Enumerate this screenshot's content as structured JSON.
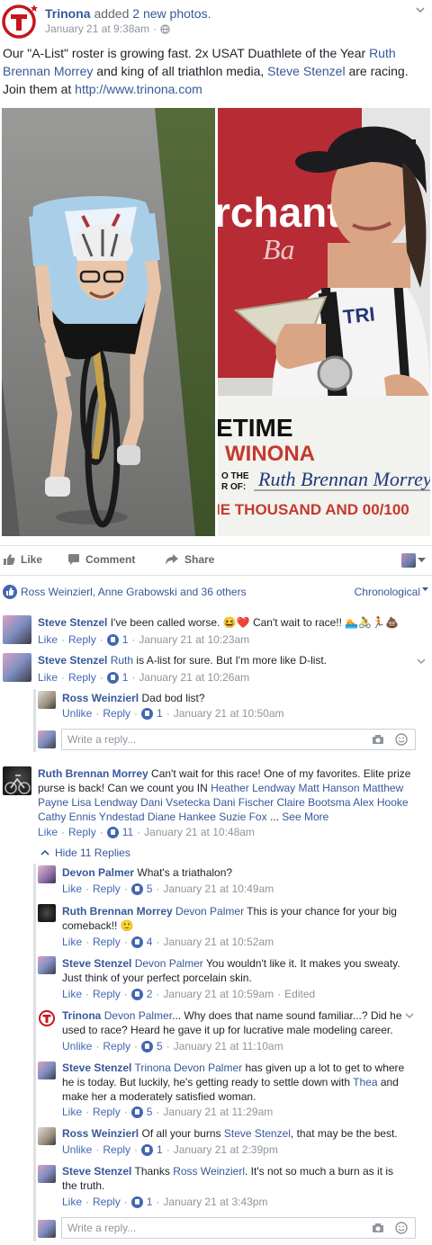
{
  "post": {
    "page_name": "Trinona",
    "action": "added",
    "photo_count": "2 new photos",
    "period": ".",
    "timestamp": "January 21 at 9:38am",
    "privacy_icon": "globe-icon",
    "text": {
      "p1": "Our \"A-List\" roster is growing fast. 2x USAT Duathlete of the Year ",
      "link1": "Ruth Brennan Morrey",
      "p2": " and king of all triathlon media, ",
      "link2": "Steve Stenzel",
      "p3": " are racing. Join them at ",
      "url": "http://www.trinona.com"
    },
    "photo2_text": {
      "banner": "rchants",
      "banner2": "Ba",
      "check_top": "ETIME",
      "check_org": "WINONA",
      "to_the": "O THE",
      "order_of": "R OF:",
      "payee": "Ruth Brennan Morrey",
      "amount": "IE THOUSAND AND 00/100"
    }
  },
  "actions": {
    "like": "Like",
    "comment": "Comment",
    "share": "Share"
  },
  "reactions": {
    "text": "Ross Weinzierl, Anne Grabowski and 36 others",
    "order": "Chronological"
  },
  "comments": [
    {
      "name": "Steve Stenzel",
      "text": "I've been called worse. 😆❤️ Can't wait to race!! 🏊🚴🏃💩",
      "like": "Like",
      "reply": "Reply",
      "count": "1",
      "time": "January 21 at 10:23am"
    },
    {
      "name": "Steve Stenzel",
      "mention": "Ruth",
      "text": " is A-list for sure. But I'm more like D-list.",
      "like": "Like",
      "reply": "Reply",
      "count": "1",
      "time": "January 21 at 10:26am",
      "replies": [
        {
          "name": "Ross Weinzierl",
          "text": "Dad bod list?",
          "like": "Unlike",
          "reply": "Reply",
          "count": "1",
          "time": "January 21 at 10:50am"
        }
      ]
    },
    {
      "name": "Ruth Brennan Morrey",
      "text": "Can't wait for this race! One of my favorites. Elite prize purse is back! Can we count you IN ",
      "tags": "Heather Lendway Matt Hanson Matthew Payne Lisa Lendway Dani Vsetecka Dani Fischer Claire Bootsma Alex Hooke Cathy Ennis Yndestad Diane Hankee Suzie Fox",
      "ellipsis": " ... ",
      "see_more": "See More",
      "like": "Like",
      "reply": "Reply",
      "count": "11",
      "time": "January 21 at 10:48am",
      "hide_replies": "Hide 11 Replies",
      "replies": [
        {
          "name": "Devon Palmer",
          "text": "What's a triathalon?",
          "like": "Like",
          "reply": "Reply",
          "count": "5",
          "time": "January 21 at 10:49am"
        },
        {
          "name": "Ruth Brennan Morrey",
          "mention": "Devon Palmer",
          "text": " This is your chance for your big comeback!! 🙂",
          "like": "Like",
          "reply": "Reply",
          "count": "4",
          "time": "January 21 at 10:52am"
        },
        {
          "name": "Steve Stenzel",
          "mention": "Devon Palmer",
          "text": " You wouldn't like it. It makes you sweaty. Just think of your perfect porcelain skin.",
          "like": "Like",
          "reply": "Reply",
          "count": "2",
          "time": "January 21 at 10:59am",
          "edited": "Edited"
        },
        {
          "name": "Trinona",
          "mention": "Devon Palmer",
          "text": "... Why does that name sound familiar...? Did he used to race? Heard he gave it up for lucrative male modeling career.",
          "like": "Unlike",
          "reply": "Reply",
          "count": "5",
          "time": "January 21 at 11:10am"
        },
        {
          "name": "Steve Stenzel",
          "mention": "Trinona Devon Palmer",
          "text": " has given up a lot to get to where he is today. But luckily, he's getting ready to settle down with ",
          "mention2": "Thea",
          "text2": " and make her a moderately satisfied woman.",
          "like": "Like",
          "reply": "Reply",
          "count": "5",
          "time": "January 21 at 11:29am"
        },
        {
          "name": "Ross Weinzierl",
          "text": "Of all your burns ",
          "mention": "Steve Stenzel",
          "text2": ", that may be the best.",
          "like": "Unlike",
          "reply": "Reply",
          "count": "1",
          "time": "January 21 at 2:39pm"
        },
        {
          "name": "Steve Stenzel",
          "text": "Thanks ",
          "mention": "Ross Weinzierl",
          "text2": ". It's not so much a burn as it is the truth.",
          "like": "Like",
          "reply": "Reply",
          "count": "1",
          "time": "January 21 at 3:43pm"
        }
      ]
    }
  ],
  "reply_placeholder": "Write a reply...",
  "colors": {
    "link": "#365899",
    "accent": "#4267b2",
    "meta": "#90949c",
    "brand_red": "#c4161c"
  }
}
